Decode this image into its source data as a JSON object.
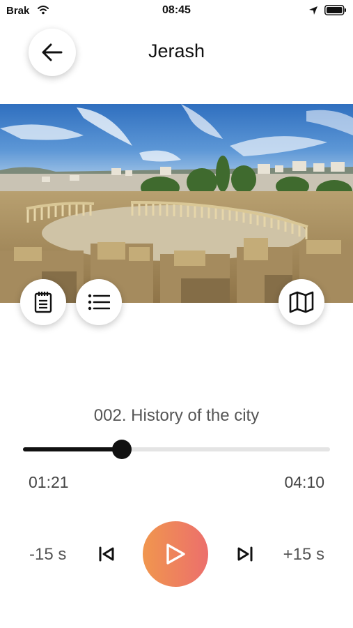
{
  "status_bar": {
    "carrier": "Brak",
    "time": "08:45"
  },
  "header": {
    "title": "Jerash",
    "back_icon": "arrow-left-icon"
  },
  "hero": {
    "image": "jerash-oval-plaza-photo"
  },
  "actions": {
    "notes_icon": "notepad-icon",
    "list_icon": "list-icon",
    "map_icon": "map-icon"
  },
  "player": {
    "track_title": "002. History of the city",
    "elapsed": "01:21",
    "total": "04:10",
    "progress_fraction": 0.323,
    "skip_back_label": "-15 s",
    "skip_forward_label": "+15 s"
  },
  "colors": {
    "play_gradient_start": "#f0964e",
    "play_gradient_end": "#ec6f6c",
    "progress_fill": "#111111",
    "progress_track": "#e4e4e4"
  }
}
